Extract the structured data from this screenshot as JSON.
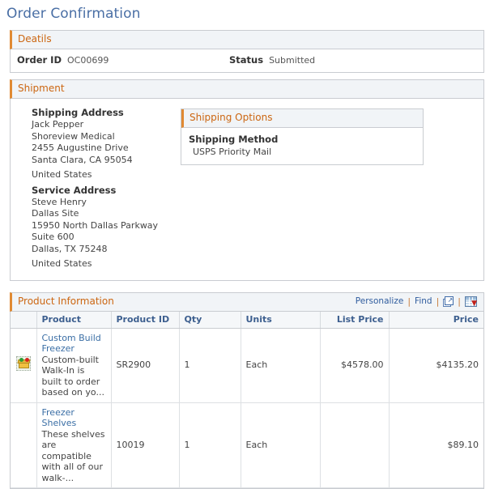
{
  "page": {
    "title": "Order Confirmation"
  },
  "details": {
    "header": "Deatils",
    "order_id_label": "Order ID",
    "order_id_value": "OC00699",
    "status_label": "Status",
    "status_value": "Submitted"
  },
  "shipment": {
    "header": "Shipment",
    "shipping_address": {
      "title": "Shipping Address",
      "lines": [
        "Jack Pepper",
        "Shoreview Medical",
        "2455 Augustine Drive",
        "Santa Clara, CA 95054"
      ],
      "country": "United States"
    },
    "service_address": {
      "title": "Service Address",
      "lines": [
        "Steve Henry",
        "Dallas Site",
        "15950 North Dallas Parkway",
        "Suite 600",
        "Dallas, TX 75248"
      ],
      "country": "United States"
    },
    "shipping_options": {
      "header": "Shipping Options",
      "method_label": "Shipping Method",
      "method_value": "USPS Priority Mail"
    }
  },
  "product_information": {
    "header": "Product Information",
    "toolbar": {
      "personalize": "Personalize",
      "find": "Find",
      "separator": "|",
      "expand_icon": "expand-window-icon",
      "download_icon": "download-spreadsheet-icon"
    },
    "columns": [
      {
        "label": "",
        "align": "left"
      },
      {
        "label": "Product",
        "align": "left"
      },
      {
        "label": "Product ID",
        "align": "left"
      },
      {
        "label": "Qty",
        "align": "left"
      },
      {
        "label": "Units",
        "align": "left"
      },
      {
        "label": "List Price",
        "align": "right"
      },
      {
        "label": "Price",
        "align": "right"
      }
    ],
    "rows": [
      {
        "thumbnail": "product-package-icon",
        "product_name": "Custom Build Freezer",
        "product_description": "Custom-built Walk-In is built to order based on yo...",
        "product_id": "SR2900",
        "qty": "1",
        "units": "Each",
        "list_price": "$4578.00",
        "price": "$4135.20"
      },
      {
        "thumbnail": "",
        "product_name": "Freezer Shelves",
        "product_description": "These shelves are compatible with all of our walk-...",
        "product_id": "10019",
        "qty": "1",
        "units": "Each",
        "list_price": "",
        "price": "$89.10"
      }
    ]
  },
  "colors": {
    "title": "#4a6fa5",
    "section_header_text": "#cc6611",
    "section_header_bg": "#f1f4f7",
    "accent_bar": "#e08a33",
    "link": "#3a6ea5",
    "table_header_text": "#3d5f8f",
    "border": "#c9ccd1"
  }
}
